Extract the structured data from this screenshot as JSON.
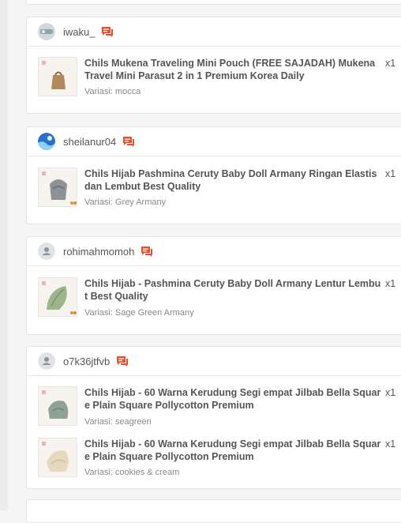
{
  "orders": [
    {
      "username": "iwaku_",
      "items": [
        {
          "title": "Chils Mukena Traveling Mini Pouch (FREE SAJADAH) Mukena Travel Mini Parasut 2 in 1 Premium Korea Daily",
          "variant": "Variasi: mocca",
          "qty": "x1"
        }
      ]
    },
    {
      "username": "sheilanur04",
      "items": [
        {
          "title": "Chils Hijab Pashmina Ceruty Baby Doll Armany Ringan Elastis dan Lembut Best Quality",
          "variant": "Variasi: Grey Armany",
          "qty": "x1"
        }
      ]
    },
    {
      "username": "rohimahmomoh",
      "items": [
        {
          "title": "Chils Hijab - Pashmina Ceruty Baby Doll Armany Lentur Lembut Best Quality",
          "variant": "Variasi: Sage Green Armany",
          "qty": "x1"
        }
      ]
    },
    {
      "username": "o7k36jtfvb",
      "items": [
        {
          "title": "Chils Hijab - 60 Warna Kerudung Segi empat Jilbab Bella Square Plain Square Pollycotton Premium",
          "variant": "Variasi: seagreen",
          "qty": "x1"
        },
        {
          "title": "Chils Hijab - 60 Warna Kerudung Segi empat Jilbab Bella Square Plain Square Pollycotton Premium",
          "variant": "Variasi: cookies & cream",
          "qty": "x1"
        }
      ]
    }
  ],
  "colors": {
    "chat_icon": "#ee4d2d",
    "text": "#555555",
    "variant": "#888888"
  },
  "icons": {
    "chat": "chat-icon",
    "avatar_default": "person-icon"
  }
}
